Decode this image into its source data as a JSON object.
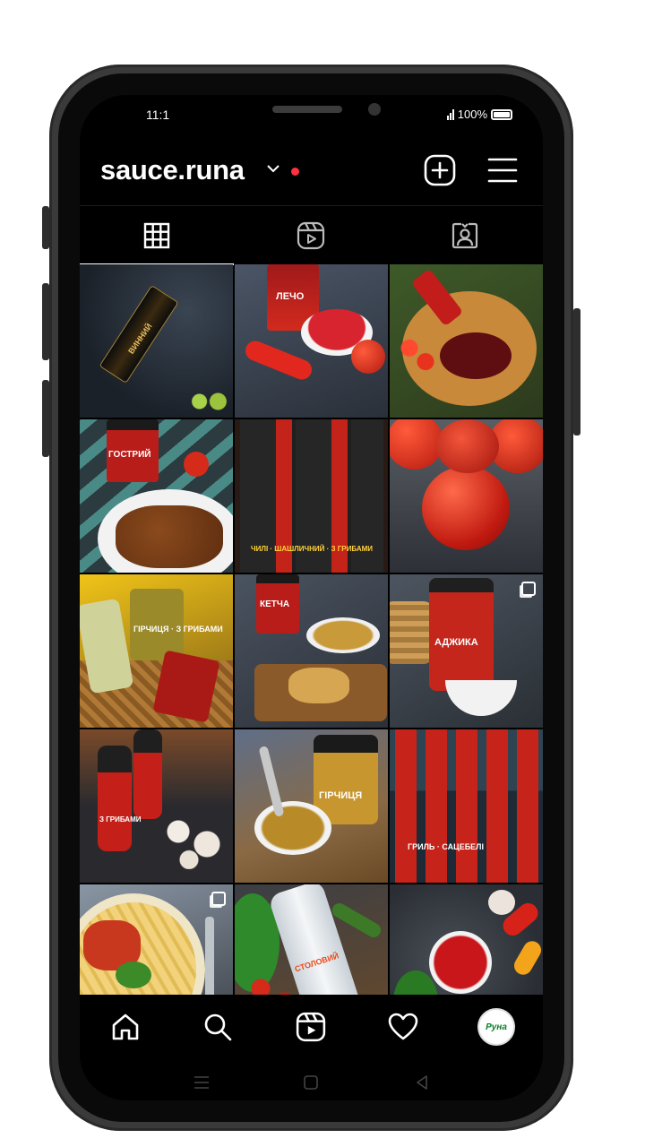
{
  "status_bar": {
    "time": "11:1",
    "battery": "100%"
  },
  "profile": {
    "username": "sauce.runa"
  },
  "header_icons": [
    "chevron-down-icon",
    "notification-dot",
    "plus-square-icon",
    "hamburger-menu-icon"
  ],
  "tabs": [
    {
      "name": "posts-grid",
      "icon": "grid-icon",
      "selected": true
    },
    {
      "name": "reels",
      "icon": "reels-icon",
      "selected": false
    },
    {
      "name": "tagged",
      "icon": "tagged-person-icon",
      "selected": false
    }
  ],
  "posts": [
    {
      "label": "ВИННИЙ",
      "multi": false
    },
    {
      "label": "ЛЕЧО",
      "multi": false
    },
    {
      "label": "",
      "multi": false
    },
    {
      "label": "ГОСТРИЙ",
      "multi": false
    },
    {
      "label": "ЧИЛІ · ШАШЛИЧНИЙ · З ГРИБАМИ",
      "multi": false
    },
    {
      "label": "",
      "multi": false
    },
    {
      "label": "ГІРЧИЦЯ · З ГРИБАМИ",
      "multi": false
    },
    {
      "label": "КЕТЧА",
      "multi": false
    },
    {
      "label": "АДЖИКА",
      "multi": true
    },
    {
      "label": "З ГРИБАМИ",
      "multi": false
    },
    {
      "label": "ГІРЧИЦЯ",
      "multi": false
    },
    {
      "label": "ГРИЛЬ · САЦЕБЕЛІ",
      "multi": false
    },
    {
      "label": "",
      "multi": true
    },
    {
      "label": "СТОЛОВИЙ",
      "multi": false
    },
    {
      "label": "",
      "multi": false
    }
  ],
  "brand_label": "Руна",
  "bottom_nav": [
    "home-icon",
    "search-icon",
    "reels-icon",
    "heart-icon",
    "profile-avatar"
  ],
  "colors": {
    "background": "#000000",
    "notification": "#ff3040",
    "brand_green": "#0a7d2a"
  }
}
